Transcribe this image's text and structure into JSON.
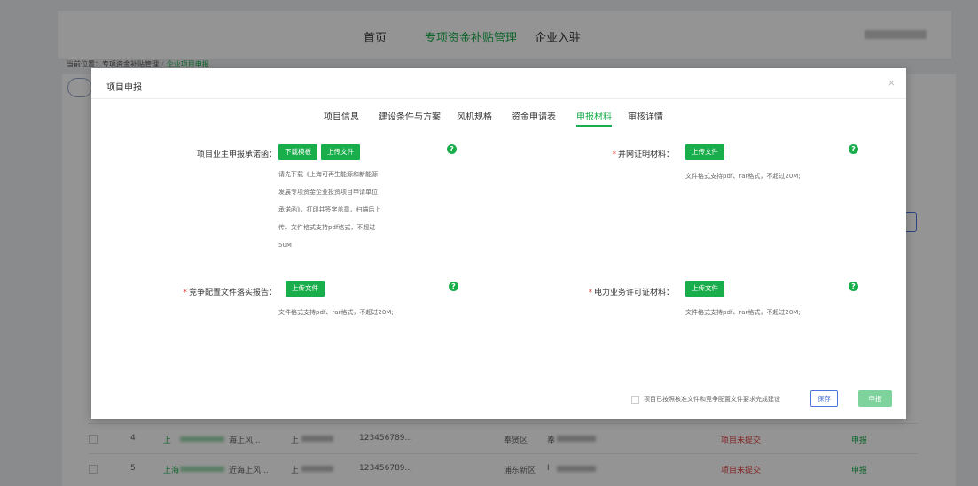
{
  "nav": {
    "home": "首页",
    "subsidy": "专项资金补贴管理",
    "enterprise": "企业入驻"
  },
  "breadcrumb": {
    "prefix": "当前位置：",
    "parent": "专项资金补贴管理",
    "current": "企业项目申报"
  },
  "table": {
    "rows": [
      {
        "index": "4",
        "name_start": "上",
        "name_mid": "海上风...",
        "company_start": "上",
        "number": "123456789...",
        "district": "奉贤区",
        "person_start": "奉",
        "status": "项目未提交",
        "action": "申报"
      },
      {
        "index": "5",
        "name_start": "上海",
        "name_mid": "近海上风...",
        "company_start": "上",
        "number": "123456789...",
        "district": "浦东新区",
        "person_start": "I",
        "status": "项目未提交",
        "action": "申报"
      }
    ]
  },
  "modal": {
    "title": "项目申报",
    "close": "×",
    "tabs": [
      "项目信息",
      "建设条件与方案",
      "风机规格",
      "资金申请表",
      "申报材料",
      "审核详情"
    ],
    "active_tab_index": 4,
    "fields": {
      "owner_commitment": {
        "label": "项目业主申报承诺函：",
        "download_button": "下载模板",
        "upload_button": "上传文件",
        "hint": "请先下载《上海可再生能源和新能源发展专项资金企业投资项目申请单位承诺函》，打印并签字盖章，扫描后上传。文件格式支持pdf格式，不超过50M"
      },
      "grid_proof": {
        "label": "并网证明材料：",
        "required": "*",
        "upload_button": "上传文件",
        "hint": "文件格式支持pdf、rar格式，不超过20M;"
      },
      "competitive_config": {
        "label": "竞争配置文件落实报告：",
        "required": "*",
        "upload_button": "上传文件",
        "hint": "文件格式支持pdf、rar格式，不超过20M;"
      },
      "power_license": {
        "label": "电力业务许可证材料：",
        "required": "*",
        "upload_button": "上传文件",
        "hint": "文件格式支持pdf、rar格式，不超过20M;"
      }
    },
    "help_glyph": "?",
    "confirm_text": "项目已按照核准文件和竞争配置文件要求完成建设",
    "save_button": "保存",
    "submit_button": "申报"
  },
  "colors": {
    "brand_green": "#1aad4b",
    "link_blue": "#4a74d9",
    "status_red": "#e03c3c"
  }
}
